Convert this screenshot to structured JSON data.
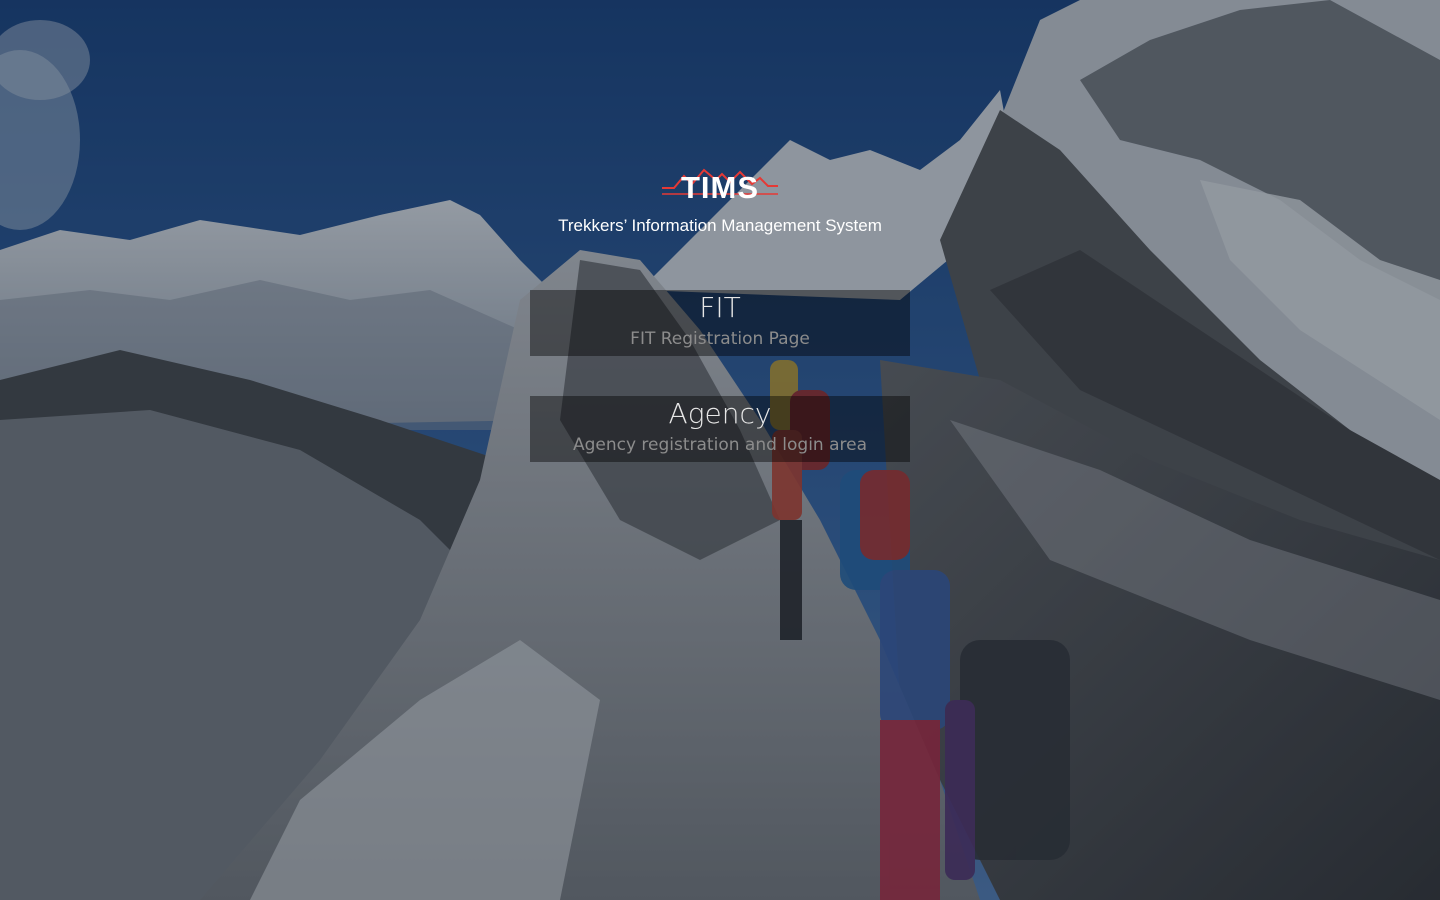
{
  "brand": {
    "logo_text": "TIMS",
    "tagline": "Trekkers’ Information Management System",
    "accent_color": "#e53935"
  },
  "options": [
    {
      "title": "FIT",
      "subtitle": "FIT Registration Page"
    },
    {
      "title": "Agency",
      "subtitle": "Agency registration and login area"
    }
  ],
  "background": {
    "description_icon": "mountain-trekkers-photo"
  }
}
